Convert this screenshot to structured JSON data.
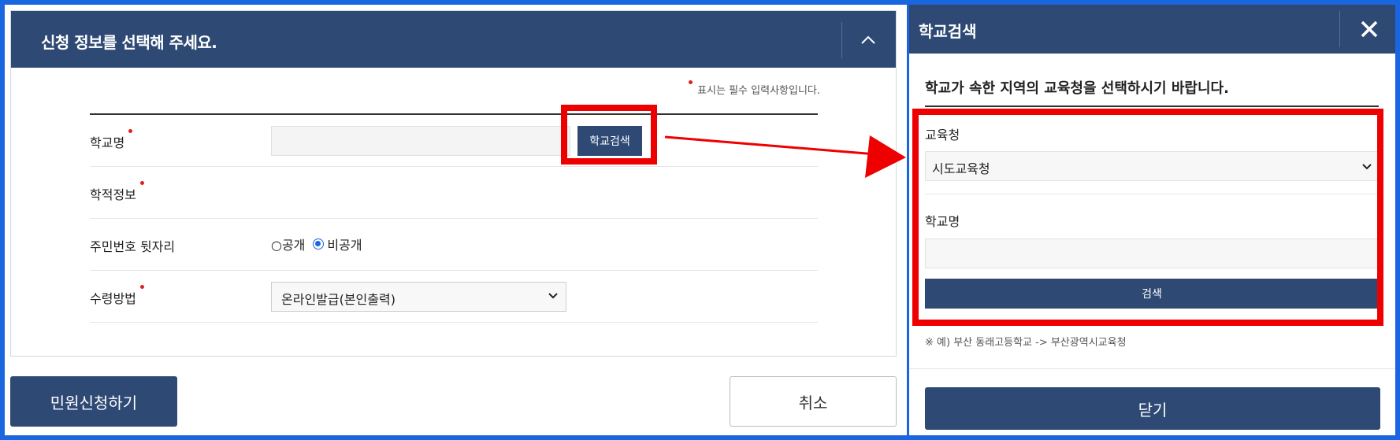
{
  "left": {
    "header_title": "신청 정보를 선택해 주세요.",
    "required_note": "표시는 필수 입력사항입니다.",
    "rows": {
      "school": {
        "label": "학교명",
        "button": "학교검색"
      },
      "record": {
        "label": "학적정보"
      },
      "ssn": {
        "label": "주민번호 뒷자리",
        "option_public": "○공개",
        "option_private": "비공개",
        "selected": "비공개"
      },
      "receive": {
        "label": "수령방법",
        "selected": "온라인발급(본인출력)"
      }
    },
    "apply_button": "민원신청하기",
    "cancel_button": "취소"
  },
  "right": {
    "header_title": "학교검색",
    "instruction": "학교가 속한 지역의 교육청을 선택하시기 바랍니다.",
    "office_label": "교육청",
    "office_selected": "시도교육청",
    "school_label": "학교명",
    "search_button": "검색",
    "example": "※ 예) 부산 동래고등학교 -> 부산광역시교육청",
    "close_button": "닫기"
  },
  "colors": {
    "brand": "#2e4a74",
    "highlight": "#ee0000",
    "frame": "#1a66e0"
  },
  "icons": {
    "collapse": "chevron-up-icon",
    "close": "close-icon",
    "dropdown": "chevron-down-icon"
  }
}
